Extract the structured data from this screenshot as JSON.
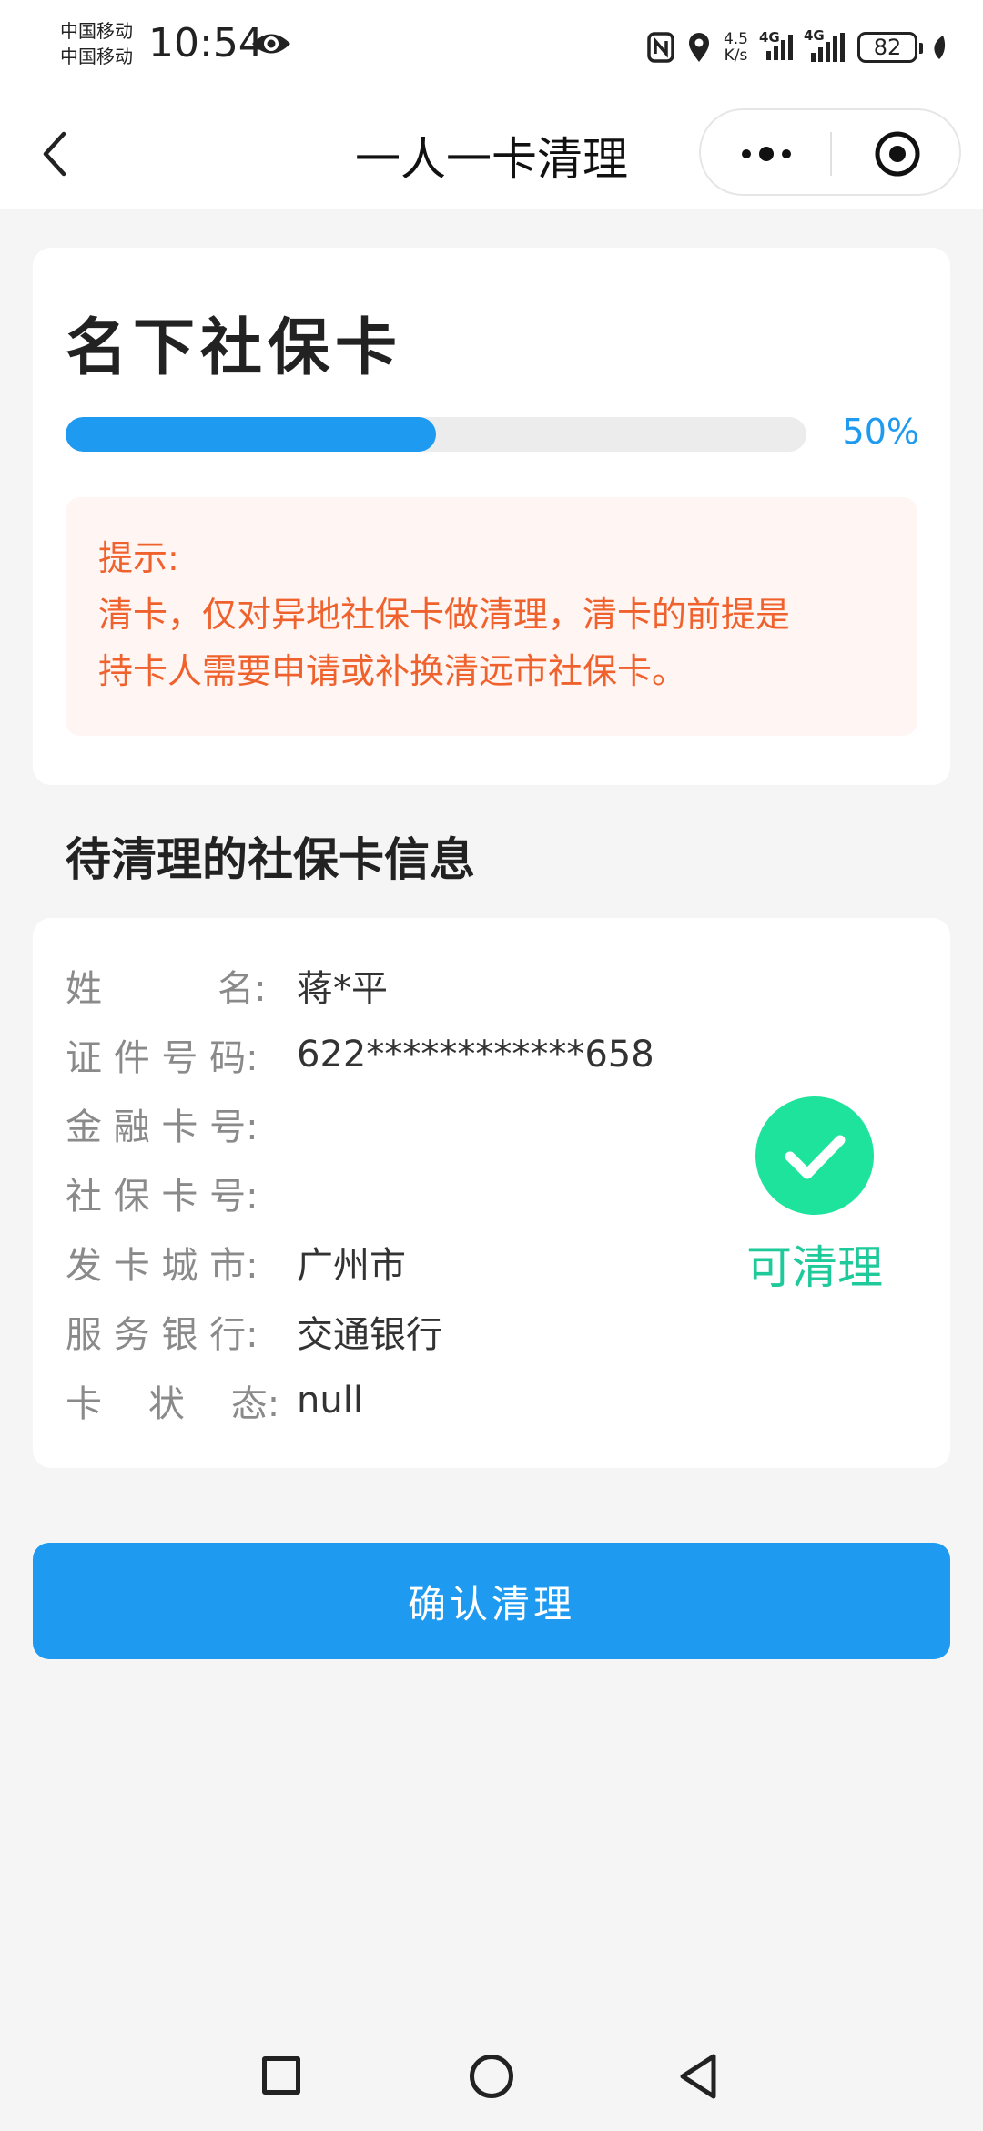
{
  "status_bar": {
    "carrier_1": "中国移动",
    "carrier_2": "中国移动",
    "time": "10:54",
    "speed_value": "4.5",
    "speed_unit": "K/s",
    "network_1": "4G",
    "network_2": "4G",
    "battery": "82"
  },
  "nav": {
    "title": "一人一卡清理"
  },
  "summary_card": {
    "title": "名下社保卡",
    "progress_fraction": 0.5,
    "progress_label": "50%",
    "tip_title": "提示:",
    "tip_line_1": "清卡，仅对异地社保卡做清理，清卡的前提是",
    "tip_line_2": "持卡人需要申请或补换清远市社保卡。"
  },
  "section_title": "待清理的社保卡信息",
  "info": {
    "rows": [
      {
        "label": "姓          名:",
        "value": "蒋*平"
      },
      {
        "label": "证 件 号 码:",
        "value": "622************658"
      },
      {
        "label": "金 融 卡 号:",
        "value": ""
      },
      {
        "label": "社 保 卡 号:",
        "value": ""
      },
      {
        "label": "发 卡 城 市:",
        "value": "广州市"
      },
      {
        "label": "服 务 银 行:",
        "value": "交通银行"
      },
      {
        "label": "卡    状    态:",
        "value": "null"
      }
    ],
    "status_text": "可清理",
    "status_color": "#1ec99a"
  },
  "confirm_button": "确认清理",
  "colors": {
    "accent": "#1e9bf0",
    "tip_text": "#f0622d",
    "tip_bg": "#fff5f3"
  }
}
